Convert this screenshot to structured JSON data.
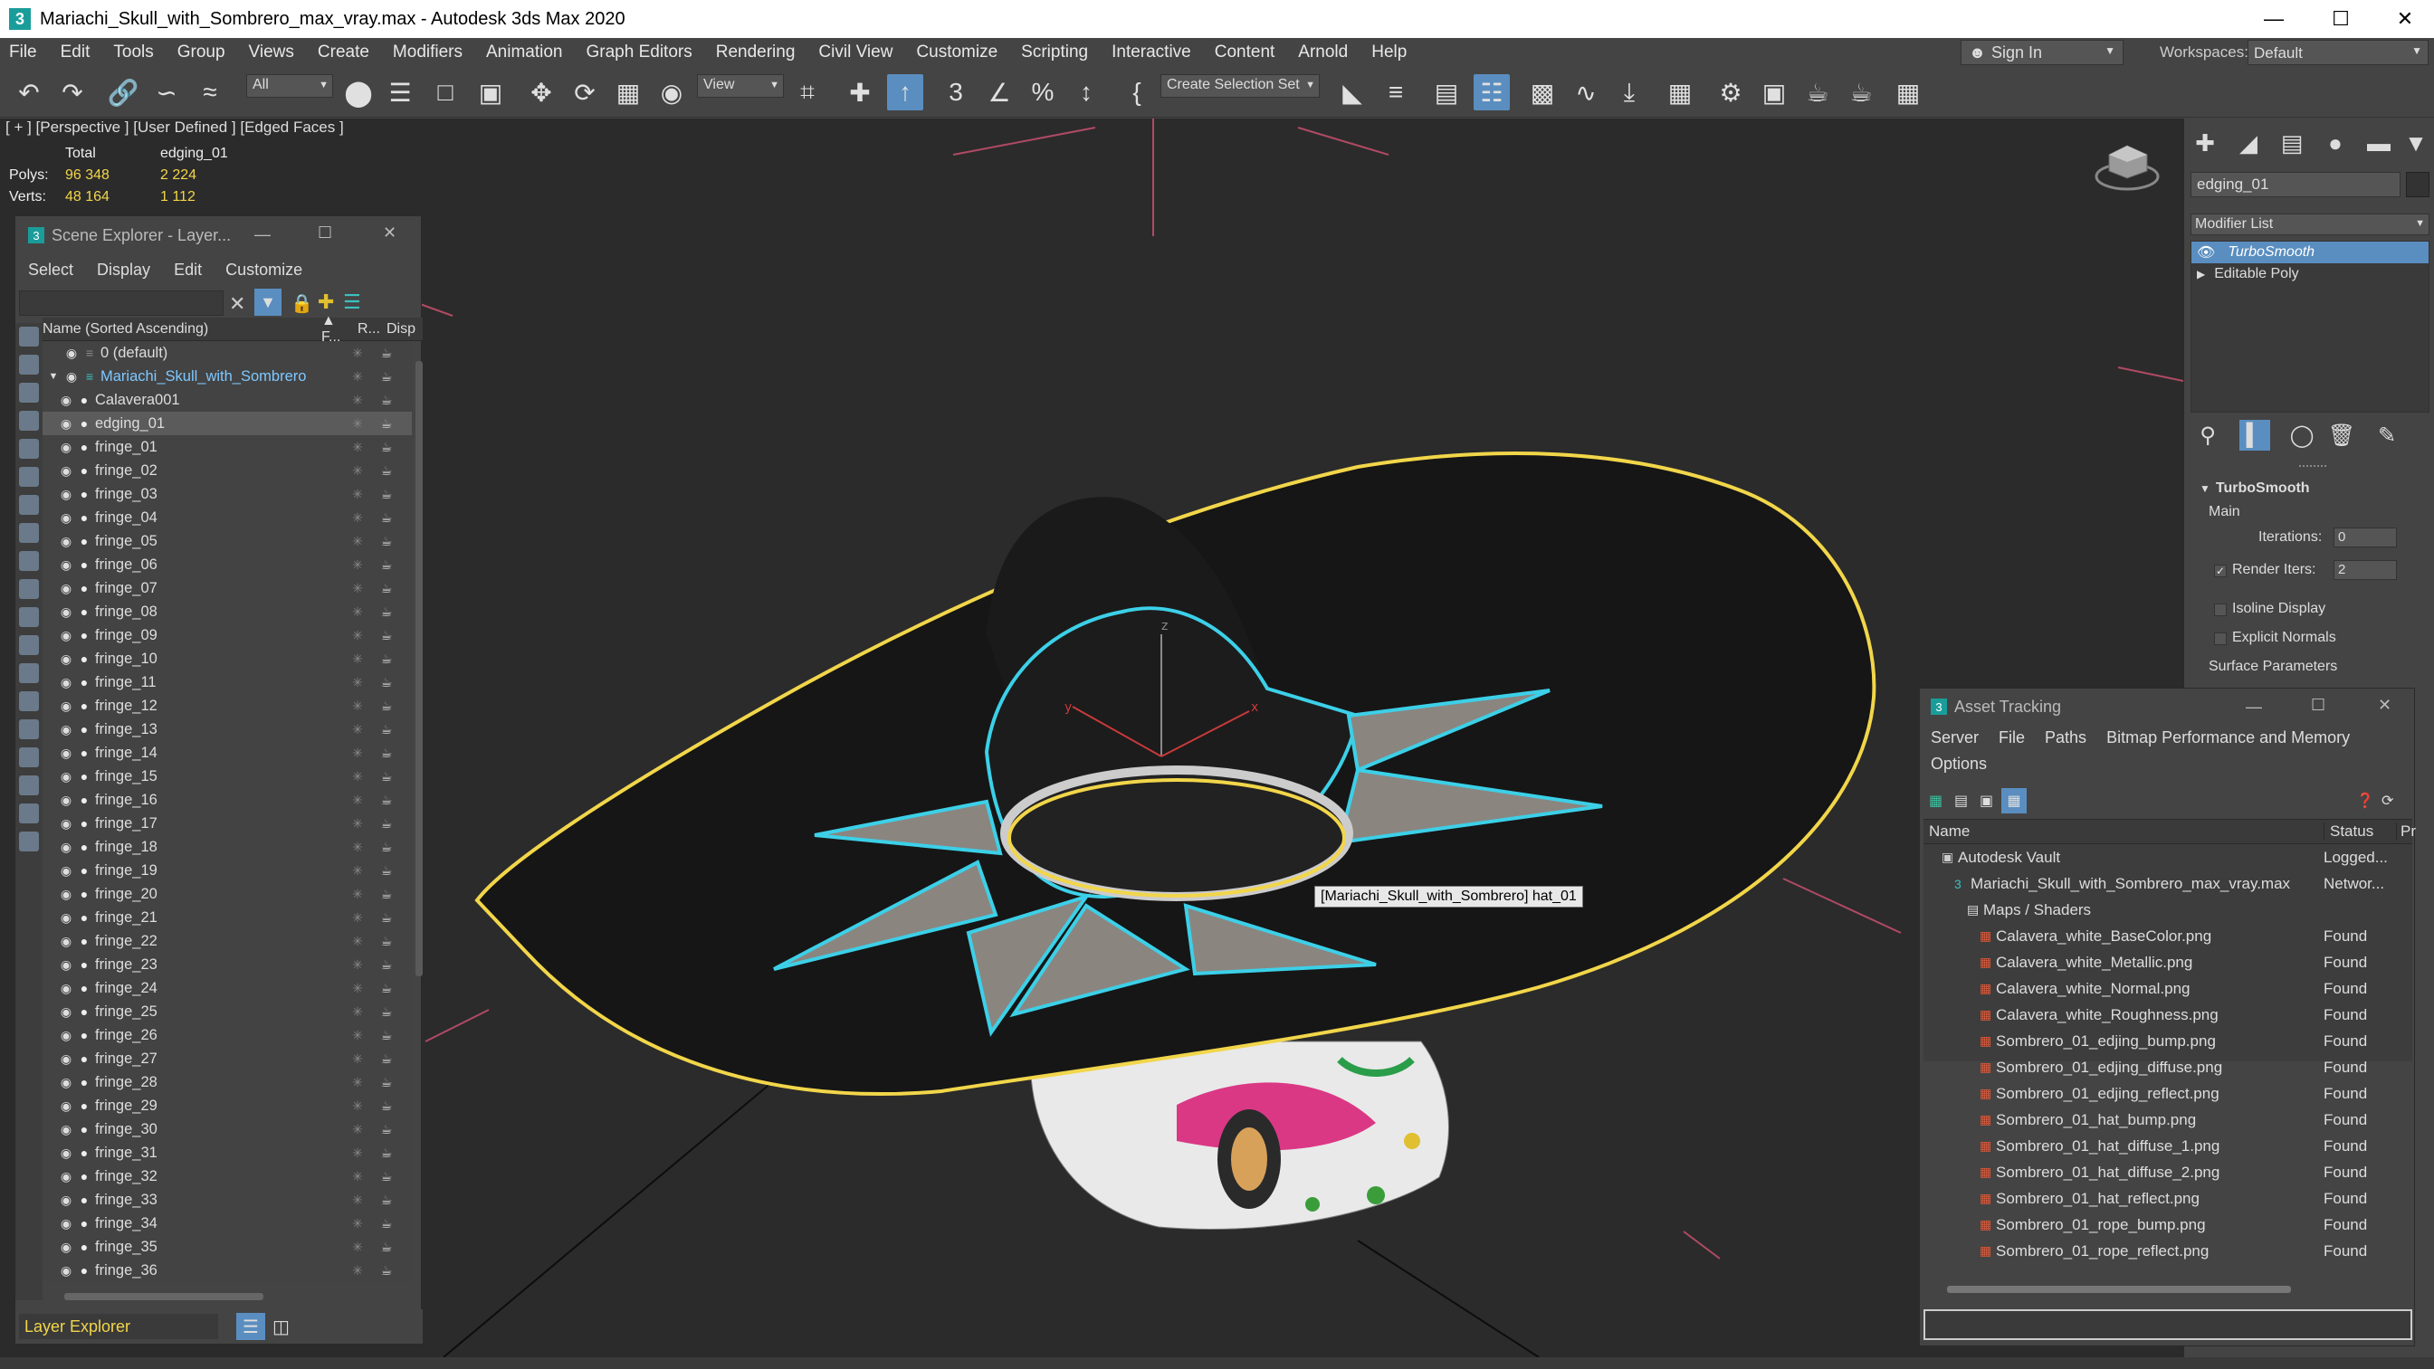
{
  "titlebar": {
    "title": "Mariachi_Skull_with_Sombrero_max_vray.max - Autodesk 3ds Max 2020",
    "app_icon": "3"
  },
  "menubar": {
    "items": [
      "File",
      "Edit",
      "Tools",
      "Group",
      "Views",
      "Create",
      "Modifiers",
      "Animation",
      "Graph Editors",
      "Rendering",
      "Civil View",
      "Customize",
      "Scripting",
      "Interactive",
      "Content",
      "Arnold",
      "Help"
    ],
    "sign_in": "Sign In",
    "workspaces_label": "Workspaces:",
    "workspace_value": "Default"
  },
  "toolbar": {
    "filter_value": "All",
    "view_value": "View",
    "selection_set": "Create Selection Set"
  },
  "viewport": {
    "label": "[ + ] [Perspective ] [User Defined ] [Edged Faces ]",
    "stats": {
      "total_label": "Total",
      "object_label": "edging_01",
      "polys_label": "Polys:",
      "polys_total": "96 348",
      "polys_obj": "2 224",
      "verts_label": "Verts:",
      "verts_total": "48 164",
      "verts_obj": "1 112"
    },
    "tooltip": "[Mariachi_Skull_with_Sombrero] hat_01",
    "axis_labels": {
      "z": "z",
      "y": "y",
      "x": "x"
    }
  },
  "scene_explorer": {
    "title": "Scene Explorer - Layer...",
    "menus": [
      "Select",
      "Display",
      "Edit",
      "Customize"
    ],
    "columns": {
      "name": "Name (Sorted Ascending)",
      "frozen": "▲ F...",
      "render": "R...",
      "disp": "Disp"
    },
    "rows": [
      {
        "label": "0 (default)",
        "indent": 1,
        "type": "layer"
      },
      {
        "label": "Mariachi_Skull_with_Sombrero",
        "indent": 0,
        "type": "layer-active"
      },
      {
        "label": "Calavera001",
        "indent": 2,
        "type": "object"
      },
      {
        "label": "edging_01",
        "indent": 2,
        "type": "object",
        "selected": true
      },
      {
        "label": "fringe_01",
        "indent": 2,
        "type": "object"
      },
      {
        "label": "fringe_02",
        "indent": 2,
        "type": "object"
      },
      {
        "label": "fringe_03",
        "indent": 2,
        "type": "object"
      },
      {
        "label": "fringe_04",
        "indent": 2,
        "type": "object"
      },
      {
        "label": "fringe_05",
        "indent": 2,
        "type": "object"
      },
      {
        "label": "fringe_06",
        "indent": 2,
        "type": "object"
      },
      {
        "label": "fringe_07",
        "indent": 2,
        "type": "object"
      },
      {
        "label": "fringe_08",
        "indent": 2,
        "type": "object"
      },
      {
        "label": "fringe_09",
        "indent": 2,
        "type": "object"
      },
      {
        "label": "fringe_10",
        "indent": 2,
        "type": "object"
      },
      {
        "label": "fringe_11",
        "indent": 2,
        "type": "object"
      },
      {
        "label": "fringe_12",
        "indent": 2,
        "type": "object"
      },
      {
        "label": "fringe_13",
        "indent": 2,
        "type": "object"
      },
      {
        "label": "fringe_14",
        "indent": 2,
        "type": "object"
      },
      {
        "label": "fringe_15",
        "indent": 2,
        "type": "object"
      },
      {
        "label": "fringe_16",
        "indent": 2,
        "type": "object"
      },
      {
        "label": "fringe_17",
        "indent": 2,
        "type": "object"
      },
      {
        "label": "fringe_18",
        "indent": 2,
        "type": "object"
      },
      {
        "label": "fringe_19",
        "indent": 2,
        "type": "object"
      },
      {
        "label": "fringe_20",
        "indent": 2,
        "type": "object"
      },
      {
        "label": "fringe_21",
        "indent": 2,
        "type": "object"
      },
      {
        "label": "fringe_22",
        "indent": 2,
        "type": "object"
      },
      {
        "label": "fringe_23",
        "indent": 2,
        "type": "object"
      },
      {
        "label": "fringe_24",
        "indent": 2,
        "type": "object"
      },
      {
        "label": "fringe_25",
        "indent": 2,
        "type": "object"
      },
      {
        "label": "fringe_26",
        "indent": 2,
        "type": "object"
      },
      {
        "label": "fringe_27",
        "indent": 2,
        "type": "object"
      },
      {
        "label": "fringe_28",
        "indent": 2,
        "type": "object"
      },
      {
        "label": "fringe_29",
        "indent": 2,
        "type": "object"
      },
      {
        "label": "fringe_30",
        "indent": 2,
        "type": "object"
      },
      {
        "label": "fringe_31",
        "indent": 2,
        "type": "object"
      },
      {
        "label": "fringe_32",
        "indent": 2,
        "type": "object"
      },
      {
        "label": "fringe_33",
        "indent": 2,
        "type": "object"
      },
      {
        "label": "fringe_34",
        "indent": 2,
        "type": "object"
      },
      {
        "label": "fringe_35",
        "indent": 2,
        "type": "object"
      },
      {
        "label": "fringe_36",
        "indent": 2,
        "type": "object"
      }
    ],
    "footer_label": "Layer Explorer"
  },
  "command_panel": {
    "object_name": "edging_01",
    "modifier_list": "Modifier List",
    "stack": [
      "TurboSmooth",
      "Editable Poly"
    ],
    "rollout_title": "TurboSmooth",
    "main_label": "Main",
    "iterations_label": "Iterations:",
    "iterations_value": "0",
    "render_iters_label": "Render Iters:",
    "render_iters_value": "2",
    "isoline_label": "Isoline Display",
    "explicit_normals_label": "Explicit Normals",
    "surface_params_label": "Surface Parameters"
  },
  "asset_tracking": {
    "title": "Asset Tracking",
    "menus_line1": [
      "Server",
      "File",
      "Paths",
      "Bitmap Performance and Memory"
    ],
    "menus_line2": [
      "Options"
    ],
    "columns": {
      "name": "Name",
      "status": "Status",
      "pr": "Pr"
    },
    "rows": [
      {
        "name": "Autodesk Vault",
        "status": "Logged...",
        "indent": 1,
        "icon": "vault"
      },
      {
        "name": "Mariachi_Skull_with_Sombrero_max_vray.max",
        "status": "Networ...",
        "indent": 2,
        "icon": "max"
      },
      {
        "name": "Maps / Shaders",
        "status": "",
        "indent": 3,
        "icon": "folder"
      },
      {
        "name": "Calavera_white_BaseColor.png",
        "status": "Found",
        "indent": 4,
        "icon": "image"
      },
      {
        "name": "Calavera_white_Metallic.png",
        "status": "Found",
        "indent": 4,
        "icon": "image"
      },
      {
        "name": "Calavera_white_Normal.png",
        "status": "Found",
        "indent": 4,
        "icon": "image"
      },
      {
        "name": "Calavera_white_Roughness.png",
        "status": "Found",
        "indent": 4,
        "icon": "image"
      },
      {
        "name": "Sombrero_01_edjing_bump.png",
        "status": "Found",
        "indent": 4,
        "icon": "image"
      },
      {
        "name": "Sombrero_01_edjing_diffuse.png",
        "status": "Found",
        "indent": 4,
        "icon": "image"
      },
      {
        "name": "Sombrero_01_edjing_reflect.png",
        "status": "Found",
        "indent": 4,
        "icon": "image"
      },
      {
        "name": "Sombrero_01_hat_bump.png",
        "status": "Found",
        "indent": 4,
        "icon": "image"
      },
      {
        "name": "Sombrero_01_hat_diffuse_1.png",
        "status": "Found",
        "indent": 4,
        "icon": "image"
      },
      {
        "name": "Sombrero_01_hat_diffuse_2.png",
        "status": "Found",
        "indent": 4,
        "icon": "image"
      },
      {
        "name": "Sombrero_01_hat_reflect.png",
        "status": "Found",
        "indent": 4,
        "icon": "image"
      },
      {
        "name": "Sombrero_01_rope_bump.png",
        "status": "Found",
        "indent": 4,
        "icon": "image"
      },
      {
        "name": "Sombrero_01_rope_reflect.png",
        "status": "Found",
        "indent": 4,
        "icon": "image"
      }
    ]
  },
  "colors": {
    "accent": "#5a8ec0",
    "selection_yellow": "#f2d64a",
    "highlight_cyan": "#3cd0e8",
    "viewport_bg": "#2b2b2b",
    "grid_pink": "#b04a64"
  }
}
